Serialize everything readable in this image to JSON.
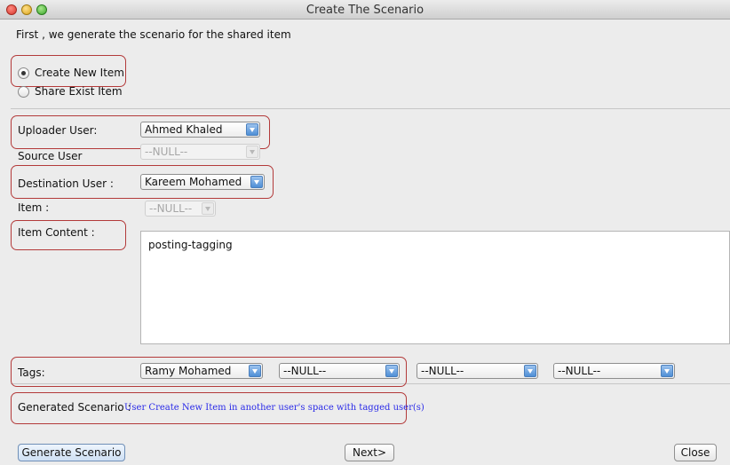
{
  "window": {
    "title": "Create The Scenario"
  },
  "intro": "First , we generate the scenario for the shared item",
  "mode": {
    "create_label": "Create New Item",
    "share_label": "Share Exist Item",
    "selected": "create"
  },
  "form": {
    "uploader": {
      "label": "Uploader User:",
      "value": "Ahmed Khaled"
    },
    "source": {
      "label": "Source User",
      "value": "--NULL--"
    },
    "destination": {
      "label": "Destination User :",
      "value": "Kareem Mohamed"
    },
    "item": {
      "label": "Item :",
      "value": "--NULL--"
    },
    "item_content": {
      "label": "Item Content :",
      "value": "posting-tagging"
    },
    "tags": {
      "label": "Tags:",
      "values": [
        "Ramy Mohamed",
        "--NULL--",
        "--NULL--",
        "--NULL--"
      ]
    },
    "generated": {
      "label": "Generated Scenario :",
      "value": "User Create New Item in another user's space with tagged user(s)"
    }
  },
  "buttons": {
    "generate": "Generate Scenario",
    "next": "Next>",
    "close": "Close"
  },
  "colors": {
    "highlight": "#b33a3a",
    "scenario_text": "#2a2ae8",
    "combo_arrow": "#4f8fd6"
  }
}
